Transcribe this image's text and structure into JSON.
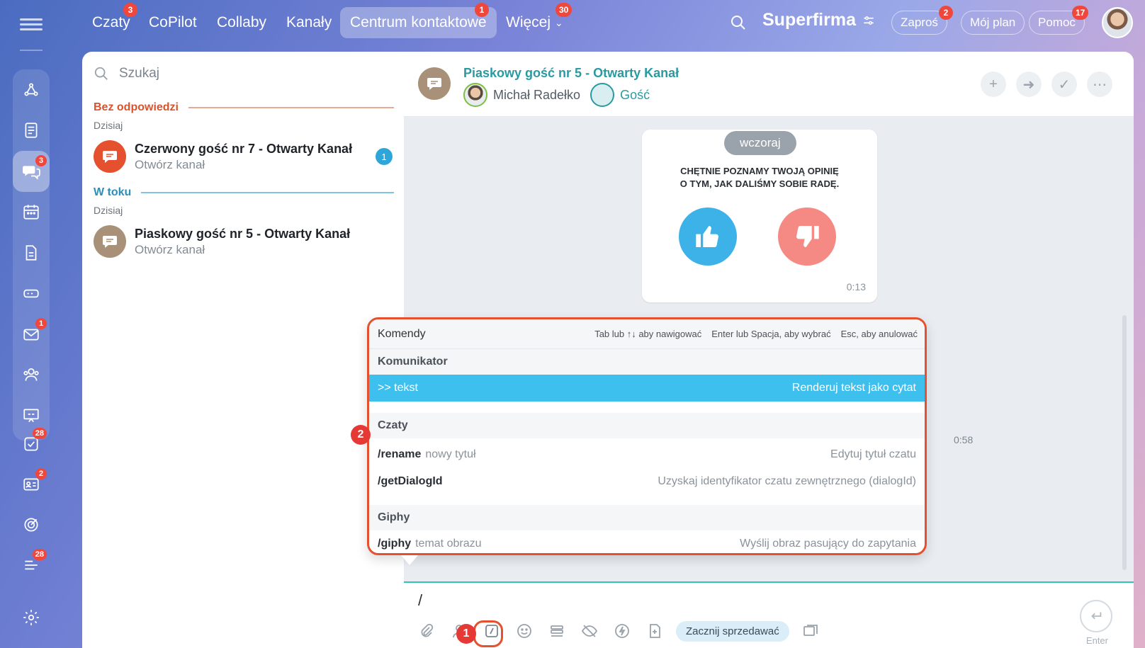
{
  "topnav": {
    "items": [
      {
        "label": "Czaty",
        "badge": "3"
      },
      {
        "label": "CoPilot",
        "badge": ""
      },
      {
        "label": "Collaby",
        "badge": ""
      },
      {
        "label": "Kanały",
        "badge": ""
      },
      {
        "label": "Centrum kontaktowe",
        "badge": "1"
      },
      {
        "label": "Więcej",
        "badge": "30"
      }
    ],
    "brand": "Superfirma",
    "invite": {
      "label": "Zaproś",
      "badge": "2"
    },
    "plan": "Mój plan",
    "help": {
      "label": "Pomoc",
      "badge": "17"
    }
  },
  "rail": {
    "badges": {
      "chats": "3",
      "mail": "1",
      "tasks": "28",
      "crm": "2",
      "feed": "28"
    }
  },
  "chatlist": {
    "search_placeholder": "Szukaj",
    "groups": [
      {
        "title": "Bez odpowiedzi",
        "day": "Dzisiaj",
        "color": "#d9532c"
      },
      {
        "title": "W toku",
        "day": "Dzisiaj",
        "color": "#2a8fbd"
      }
    ],
    "chats": [
      {
        "title": "Czerwony gość nr 7 - Otwarty Kanał",
        "sub": "Otwórz kanał",
        "count": "1"
      },
      {
        "title": "Piaskowy gość nr 5 - Otwarty Kanał",
        "sub": "Otwórz kanał",
        "count": ""
      }
    ]
  },
  "chat": {
    "title": "Piaskowy gość nr 5 - Otwarty Kanał",
    "member1": "Michał Radełko",
    "member2": "Gość",
    "date_pill": "wczoraj",
    "rating_question_1": "Chętnie poznamy Twoją opinię",
    "rating_question_2": "o tym, jak daliśmy sobie radę.",
    "rating_time": "0:13",
    "msg_time": "0:58",
    "composer_text": "/",
    "sell_label": "Zacznij sprzedawać",
    "send_label": "Enter"
  },
  "commands": {
    "title": "Komendy",
    "hint_nav": "Tab lub ↑↓ aby nawigować",
    "hint_select": "Enter lub Spacja, aby wybrać",
    "hint_cancel": "Esc, aby anulować",
    "sections": [
      {
        "name": "Komunikator",
        "items": [
          {
            "cmd": ">> tekst",
            "arg": "",
            "desc": "Renderuj tekst jako cytat"
          }
        ]
      },
      {
        "name": "Czaty",
        "items": [
          {
            "cmd": "/rename",
            "arg": "nowy tytuł",
            "desc": "Edytuj tytuł czatu"
          },
          {
            "cmd": "/getDialogId",
            "arg": "",
            "desc": "Uzyskaj identyfikator czatu zewnętrznego (dialogId)"
          }
        ]
      },
      {
        "name": "Giphy",
        "items": [
          {
            "cmd": "/giphy",
            "arg": "temat obrazu",
            "desc": "Wyślij obraz pasujący do zapytania"
          }
        ]
      }
    ]
  },
  "steps": {
    "one": "1",
    "two": "2"
  },
  "colors": {
    "accent": "#3ec0ef",
    "highlight": "#e5512f",
    "teal": "#2a9aa1"
  }
}
